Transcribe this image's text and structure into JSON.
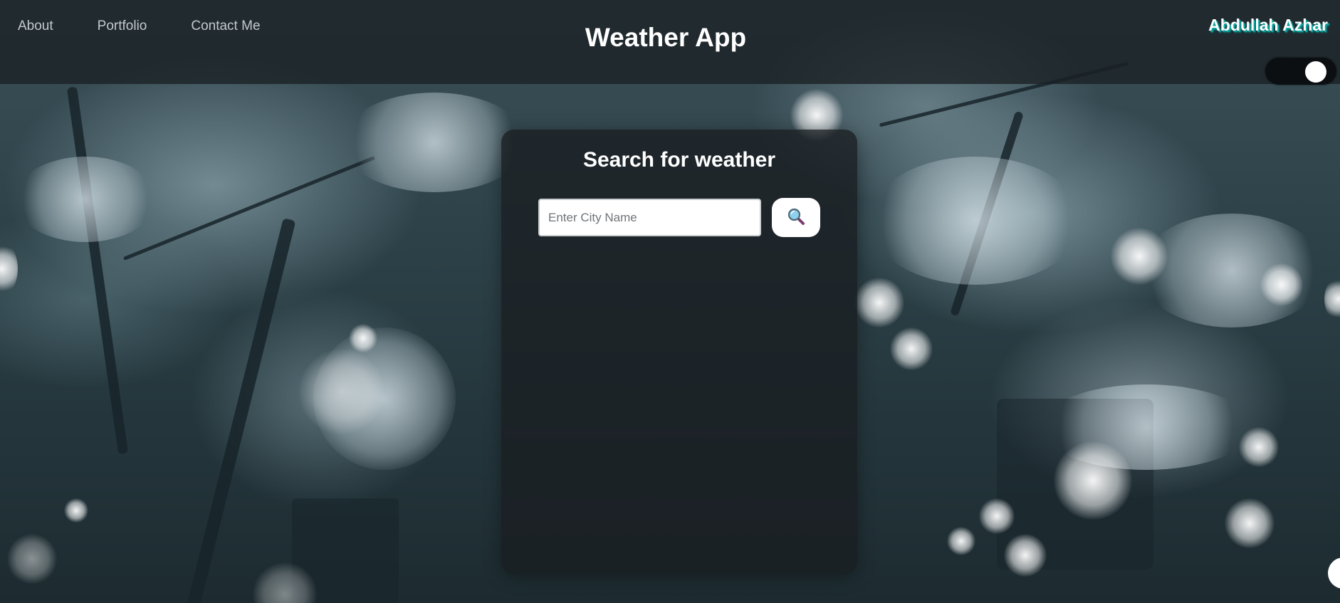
{
  "nav": {
    "items": [
      {
        "label": "About"
      },
      {
        "label": "Portfolio"
      },
      {
        "label": "Contact Me"
      }
    ]
  },
  "header": {
    "title": "Weather App",
    "brand": "Abdullah Azhar",
    "theme_toggle_state": "on"
  },
  "search": {
    "title": "Search for weather",
    "placeholder": "Enter City Name",
    "value": "",
    "button_icon": "search-icon"
  },
  "colors": {
    "brand_shadow": "#0ea5a0",
    "header_bg": "#192024",
    "card_bg": "#1a1e21"
  }
}
